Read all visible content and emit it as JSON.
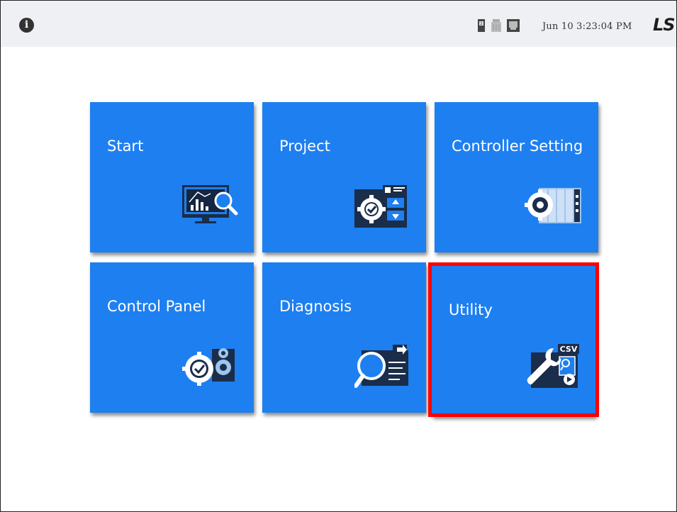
{
  "header": {
    "datetime": "Jun 10 3:23:04 PM",
    "logo_text": "LS",
    "info_icon": "info-icon",
    "status_icons": [
      "sd-card-icon",
      "usb-memory-icon",
      "network-icon"
    ]
  },
  "tiles": [
    {
      "label": "Start",
      "icon": "monitor-chart-search-icon"
    },
    {
      "label": "Project",
      "icon": "project-gear-check-icon"
    },
    {
      "label": "Controller Setting",
      "icon": "gear-plc-rack-icon"
    },
    {
      "label": "Control Panel",
      "icon": "gears-check-icon"
    },
    {
      "label": "Diagnosis",
      "icon": "magnifier-screen-icon"
    },
    {
      "label": "Utility",
      "icon": "wrench-csv-icon"
    }
  ],
  "colors": {
    "tile_bg": "#1e7ff0",
    "topbar_bg": "#eef0f4",
    "highlight": "#ff0000"
  },
  "highlighted_tile": "Utility"
}
